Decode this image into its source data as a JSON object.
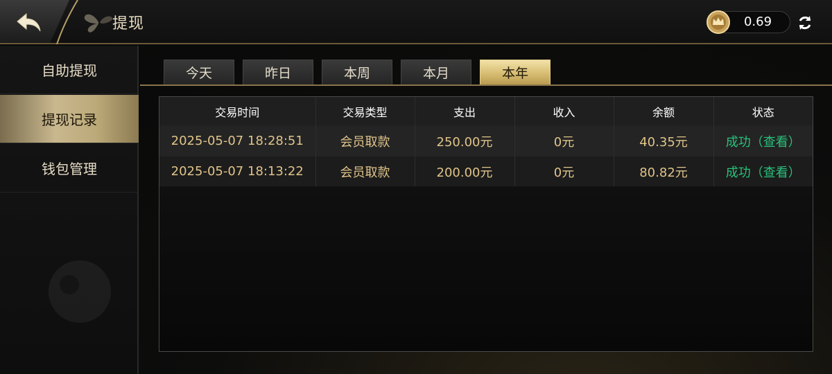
{
  "header": {
    "title": "提现",
    "balance": "0.69"
  },
  "sidebar": {
    "items": [
      {
        "label": "自助提现",
        "active": false
      },
      {
        "label": "提现记录",
        "active": true
      },
      {
        "label": "钱包管理",
        "active": false
      }
    ]
  },
  "tabs": [
    {
      "label": "今天",
      "active": false
    },
    {
      "label": "昨日",
      "active": false
    },
    {
      "label": "本周",
      "active": false
    },
    {
      "label": "本月",
      "active": false
    },
    {
      "label": "本年",
      "active": true
    }
  ],
  "table": {
    "columns": [
      "交易时间",
      "交易类型",
      "支出",
      "收入",
      "余额",
      "状态"
    ],
    "rows": [
      [
        "2025-05-07 18:28:51",
        "会员取款",
        "250.00元",
        "0元",
        "40.35元",
        "成功（查看）"
      ],
      [
        "2025-05-07 18:13:22",
        "会员取款",
        "200.00元",
        "0元",
        "80.82元",
        "成功（查看）"
      ]
    ]
  },
  "colors": {
    "accent_gold": "#d7bd72",
    "status_success": "#27c27a",
    "value_text": "#e0c48a"
  }
}
